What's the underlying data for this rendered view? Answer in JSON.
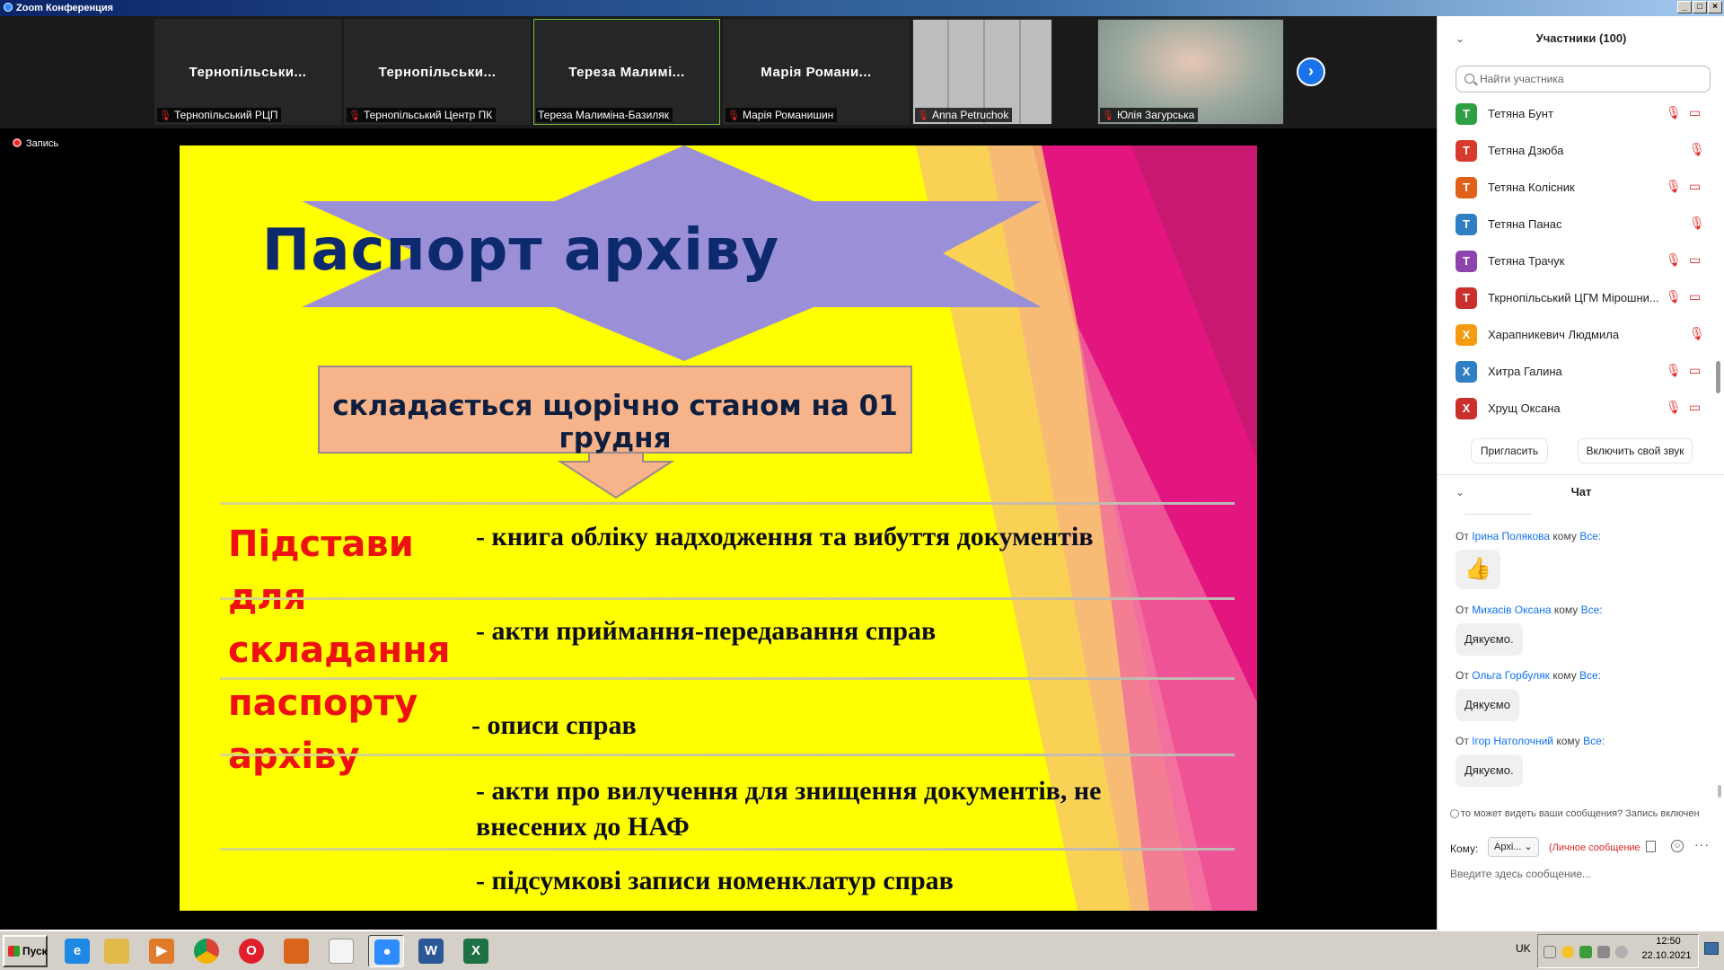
{
  "window": {
    "title": "Zoom Конференция",
    "buttons": [
      "_",
      "□",
      "×"
    ]
  },
  "video_strip": {
    "tiles": [
      {
        "display_name": "Тернопільськи...",
        "label": "Тернопільський РЦП",
        "muted": true,
        "active": false
      },
      {
        "display_name": "Тернопільськи...",
        "label": "Тернопільський Центр ПК",
        "muted": true,
        "active": false
      },
      {
        "display_name": "Тереза  Малимі...",
        "label": "Тереза Малиміна-Базиляк",
        "muted": false,
        "active": true
      },
      {
        "display_name": "Марія  Романи...",
        "label": "Марія Романишин",
        "muted": true,
        "active": false
      },
      {
        "display_name": "",
        "label": "Anna Petruchok",
        "muted": true,
        "active": false
      },
      {
        "display_name": "",
        "label": "Юлія Загурська",
        "muted": true,
        "active": false
      }
    ],
    "next_icon": "chevron-right-icon"
  },
  "recording": {
    "label": "Запись"
  },
  "slide": {
    "title": "Паспорт архіву",
    "subtitle": "складається щорічно станом на 01 грудня",
    "heading": "Підстави\nдля\nскладання\nпаспорту\nархіву",
    "items": [
      "- книга обліку надходження та вибуття документів",
      "- акти приймання-передавання справ",
      "- описи справ",
      "- акти про вилучення для знищення документів,  не",
      "внесених до НАФ",
      "- підсумкові записи номенклатур справ"
    ],
    "colors": {
      "background": "#ffff00",
      "banner": "#9b8fd8",
      "arrow_box": "#f7b38a",
      "heading": "#ee1111",
      "title": "#0e2a6e",
      "accent_pink": "#e3157f"
    }
  },
  "participants": {
    "header": "Участники (100)",
    "search_placeholder": "Найти участника",
    "list": [
      {
        "initial": "Т",
        "name": "Тетяна Бунт",
        "color": "#2ea043",
        "mic_muted": true,
        "cam_off": true
      },
      {
        "initial": "Т",
        "name": "Тетяна Дзюба",
        "color": "#d83a2e",
        "mic_muted": true,
        "cam_off": false
      },
      {
        "initial": "Т",
        "name": "Тетяна Колісник",
        "color": "#e0621a",
        "mic_muted": true,
        "cam_off": true
      },
      {
        "initial": "Т",
        "name": "Тетяна Панас",
        "color": "#2f7fc4",
        "mic_muted": true,
        "cam_off": false
      },
      {
        "initial": "Т",
        "name": "Тетяна Трачук",
        "color": "#8e44ad",
        "mic_muted": true,
        "cam_off": true
      },
      {
        "initial": "Т",
        "name": "Ткрнопільський ЦГМ Мірошни...",
        "color": "#c9302c",
        "mic_muted": true,
        "cam_off": true
      },
      {
        "initial": "Х",
        "name": "Харапникевич Людмила",
        "color": "#f39c12",
        "mic_muted": true,
        "cam_off": false
      },
      {
        "initial": "Х",
        "name": "Хитра Галина",
        "color": "#2f7fc4",
        "mic_muted": true,
        "cam_off": true
      },
      {
        "initial": "Х",
        "name": "Хрущ Оксана",
        "color": "#c9302c",
        "mic_muted": true,
        "cam_off": true
      }
    ],
    "invite_label": "Пригласить",
    "unmute_label": "Включить свой звук"
  },
  "chat": {
    "header": "Чат",
    "messages": [
      {
        "from_prefix": "От",
        "sender": "Ірина Полякова",
        "to_word": "кому",
        "recipient": "Все:",
        "text": "👍"
      },
      {
        "from_prefix": "От",
        "sender": "Михасів Оксана",
        "to_word": "кому",
        "recipient": "Все:",
        "text": "Дякуємо."
      },
      {
        "from_prefix": "От",
        "sender": "Ольга Горбуляк",
        "to_word": "кому",
        "recipient": "Все:",
        "text": "Дякуємо"
      },
      {
        "from_prefix": "От",
        "sender": "Ігор Натолочний",
        "to_word": "кому",
        "recipient": "Все:",
        "text": "Дякуємо."
      }
    ],
    "notice": "то может видеть ваши сообщения? Запись включен",
    "to_label": "Кому:",
    "to_value": "Архі...",
    "private_label": "(Личное сообщение",
    "input_placeholder": "Введите здесь сообщение..."
  },
  "taskbar": {
    "start_label": "Пуск",
    "apps": [
      {
        "icon": "internet-explorer-icon",
        "glyph": "e",
        "color": "#1e88e5"
      },
      {
        "icon": "file-manager-icon",
        "glyph": "",
        "color": "#e2b94b"
      },
      {
        "icon": "media-player-icon",
        "glyph": "▶",
        "color": "#e07b2a"
      },
      {
        "icon": "chrome-icon",
        "glyph": "",
        "color": "#db4437"
      },
      {
        "icon": "opera-icon",
        "glyph": "O",
        "color": "#e01e2c"
      },
      {
        "icon": "app-icon",
        "glyph": "",
        "color": "#d9651a"
      },
      {
        "icon": "document-icon",
        "glyph": "",
        "color": "#f4f4f4"
      },
      {
        "icon": "zoom-icon",
        "glyph": "●",
        "color": "#2d8cff"
      },
      {
        "icon": "word-icon",
        "glyph": "W",
        "color": "#2b5797"
      },
      {
        "icon": "excel-icon",
        "glyph": "X",
        "color": "#1e7145"
      }
    ],
    "language": "UK",
    "time": "12:50",
    "date": "22.10.2021"
  }
}
